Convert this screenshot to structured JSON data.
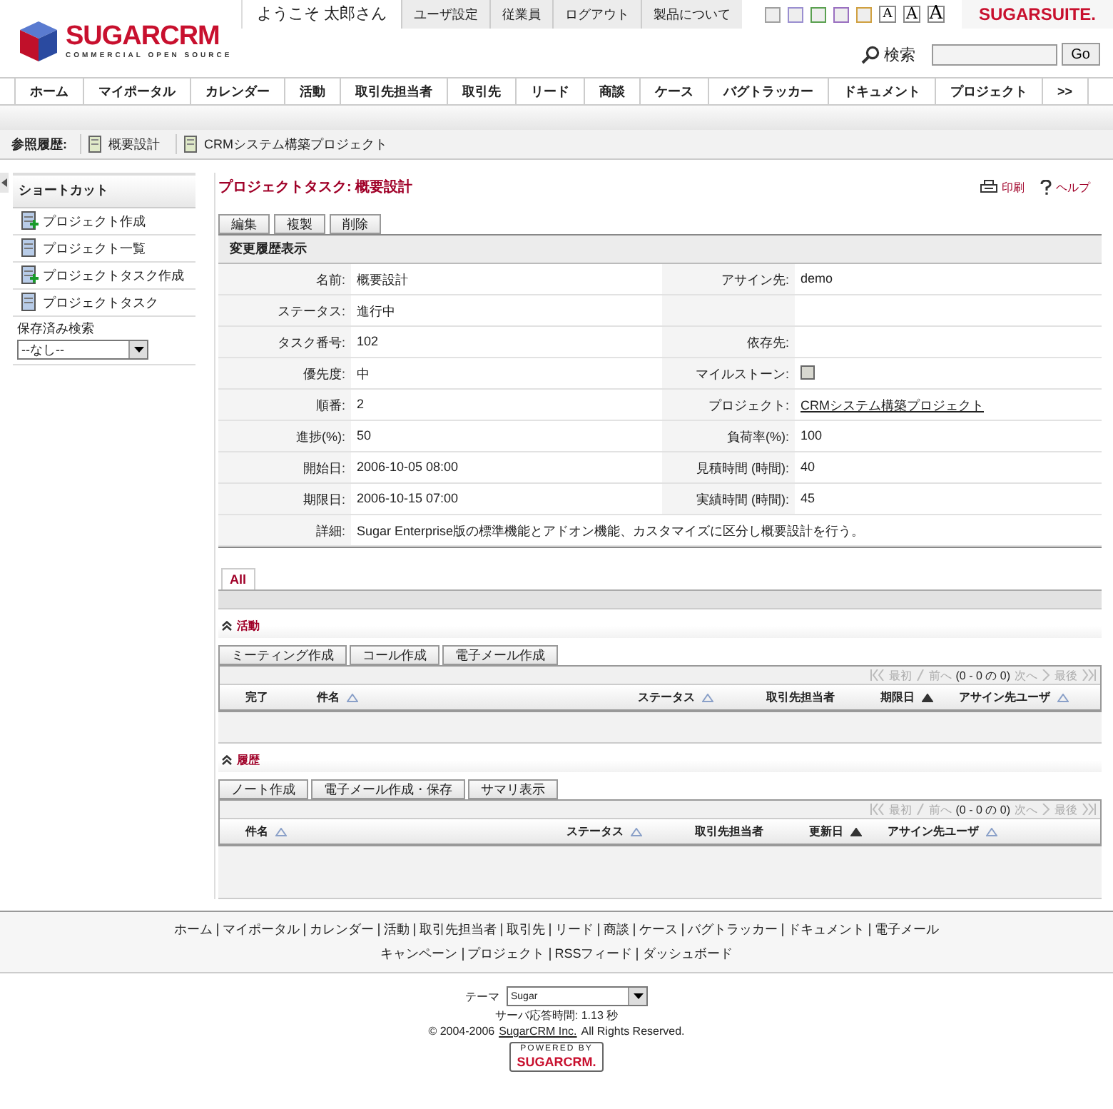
{
  "header": {
    "logo": {
      "name": "SUGARCRM",
      "tagline": "COMMERCIAL OPEN SOURCE"
    },
    "welcome": "ようこそ 太郎さん",
    "user_links": [
      "ユーザ設定",
      "従業員",
      "ログアウト",
      "製品について"
    ],
    "theme_swatches": [
      {
        "color": "#a0a0a0"
      },
      {
        "color": "#9a8fd0"
      },
      {
        "color": "#5aa050"
      },
      {
        "color": "#9a70c0"
      },
      {
        "color": "#d0a040"
      }
    ],
    "font_sizes": [
      "A",
      "A",
      "A"
    ],
    "brand": "SUGARSUITE.",
    "search": {
      "label": "検索",
      "button": "Go"
    }
  },
  "nav_tabs": [
    "ホーム",
    "マイポータル",
    "カレンダー",
    "活動",
    "取引先担当者",
    "取引先",
    "リード",
    "商談",
    "ケース",
    "バグトラッカー",
    "ドキュメント",
    "プロジェクト",
    ">>"
  ],
  "breadcrumbs": {
    "label": "参照履歴:",
    "items": [
      "概要設計",
      "CRMシステム構築プロジェクト"
    ]
  },
  "sidebar": {
    "title": "ショートカット",
    "shortcuts": [
      {
        "label": "プロジェクト作成",
        "kind": "create"
      },
      {
        "label": "プロジェクト一覧",
        "kind": "list"
      },
      {
        "label": "プロジェクトタスク作成",
        "kind": "create"
      },
      {
        "label": "プロジェクトタスク",
        "kind": "list"
      }
    ],
    "saved_search": {
      "label": "保存済み検索",
      "value": "--なし--"
    }
  },
  "main": {
    "title": "プロジェクトタスク: 概要設計",
    "actions": [
      {
        "label": "印刷",
        "kind": "print"
      },
      {
        "label": "ヘルプ",
        "kind": "help"
      }
    ],
    "buttons": [
      "編集",
      "複製",
      "削除"
    ],
    "panel_title": "変更履歴表示",
    "rows": [
      {
        "label": "名前:",
        "value": "概要設計",
        "label_2": "アサイン先:",
        "value_2": "demo",
        "kind": "text"
      },
      {
        "label": "ステータス:",
        "value": "進行中",
        "kind": "text"
      },
      {
        "label": "タスク番号:",
        "value": "102",
        "label_2": "依存先:",
        "kind": "text"
      },
      {
        "label": "優先度:",
        "value": "中",
        "label_2": "マイルストーン:",
        "kind": "checkbox",
        "checked": false
      },
      {
        "label": "順番:",
        "value": "2",
        "label_2": "プロジェクト:",
        "value_2": "CRMシステム構築プロジェクト",
        "kind": "link"
      },
      {
        "label": "進捗(%):",
        "value": "50",
        "label_2": "負荷率(%):",
        "value_2": "100",
        "kind": "text"
      },
      {
        "label": "開始日:",
        "value": "2006-10-05 08:00",
        "label_2": "見積時間 (時間):",
        "value_2": "40",
        "kind": "text"
      },
      {
        "label": "期限日:",
        "value": "2006-10-15 07:00",
        "label_2": "実績時間 (時間):",
        "value_2": "45",
        "kind": "text"
      },
      {
        "label": "詳細:",
        "value": "Sugar Enterprise版の標準機能とアドオン機能、カスタマイズに区分し概要設計を行う。",
        "kind": "wide"
      }
    ]
  },
  "subpanel_tabs": [
    {
      "label": "All",
      "selected": true
    }
  ],
  "subpanels": [
    {
      "title": "活動",
      "buttons": [
        "ミーティング作成",
        "コール作成",
        "電子メール作成"
      ],
      "pager": {
        "first": "最初",
        "prev": "前へ",
        "count": "(0 - 0 の 0)",
        "next": "次へ",
        "last": "最後"
      },
      "columns": [
        {
          "label": "完了"
        },
        {
          "label": "件名",
          "sorted": false
        },
        {
          "label": "ステータス",
          "sorted": false
        },
        {
          "label": "取引先担当者"
        },
        {
          "label": "期限日",
          "sorted": true
        },
        {
          "label": "アサイン先ユーザ",
          "sorted": false
        }
      ]
    },
    {
      "title": "履歴",
      "buttons": [
        "ノート作成",
        "電子メール作成・保存",
        "サマリ表示"
      ],
      "pager": {
        "first": "最初",
        "prev": "前へ",
        "count": "(0 - 0 の 0)",
        "next": "次へ",
        "last": "最後"
      },
      "columns": [
        {
          "label": "件名",
          "sorted": false
        },
        {
          "label": "ステータス",
          "sorted": false
        },
        {
          "label": "取引先担当者"
        },
        {
          "label": "更新日",
          "sorted": true
        },
        {
          "label": "アサイン先ユーザ",
          "sorted": false
        }
      ]
    }
  ],
  "footer": {
    "links": [
      [
        "ホーム",
        "マイポータル",
        "カレンダー",
        "活動",
        "取引先担当者",
        "取引先",
        "リード",
        "商談",
        "ケース",
        "バグトラッカー",
        "ドキュメント",
        "電子メール"
      ],
      [
        "キャンペーン",
        "プロジェクト",
        "RSSフィード",
        "ダッシュボード"
      ]
    ],
    "theme": {
      "label": "テーマ",
      "value": "Sugar"
    },
    "response_time": "サーバ応答時間: 1.13 秒",
    "copyright": {
      "prefix": "© 2004-2006",
      "link": "SugarCRM Inc.",
      "suffix": "All Rights Reserved."
    },
    "powered": {
      "top": "POWERED BY",
      "bottom": "SUGARCRM."
    }
  }
}
